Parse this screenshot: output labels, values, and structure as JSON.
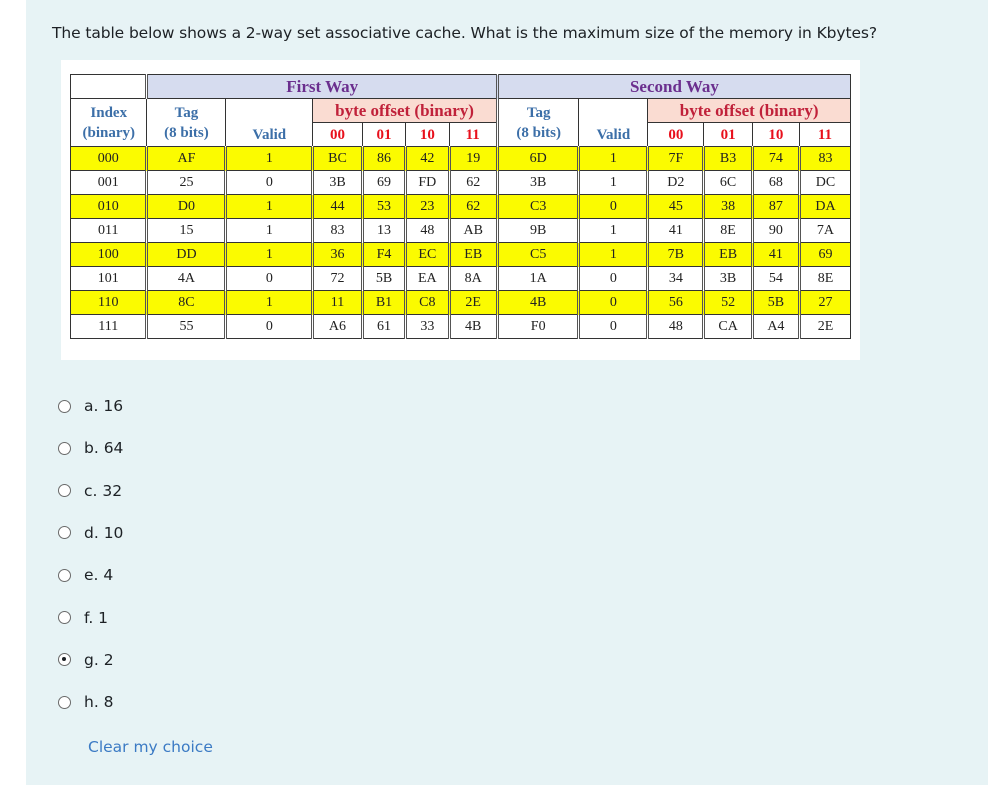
{
  "question": {
    "text": "The table below shows a 2-way set associative cache. What is the maximum size of the memory in Kbytes?"
  },
  "table": {
    "first_way_label": "First Way",
    "second_way_label": "Second Way",
    "byte_offset_label": "byte offset (binary)",
    "index_label_1": "Index",
    "index_label_2": "(binary)",
    "tag_label_1": "Tag",
    "tag_label_2": "(8 bits)",
    "valid_label": "Valid",
    "offsets": [
      "00",
      "01",
      "10",
      "11"
    ],
    "highlight_color": "#ffff00",
    "rows": [
      {
        "index": "000",
        "w1": {
          "tag": "AF",
          "valid": "1",
          "bytes": [
            "BC",
            "86",
            "42",
            "19"
          ]
        },
        "w2": {
          "tag": "6D",
          "valid": "1",
          "bytes": [
            "7F",
            "B3",
            "74",
            "83"
          ]
        },
        "highlighted": true
      },
      {
        "index": "001",
        "w1": {
          "tag": "25",
          "valid": "0",
          "bytes": [
            "3B",
            "69",
            "FD",
            "62"
          ]
        },
        "w2": {
          "tag": "3B",
          "valid": "1",
          "bytes": [
            "D2",
            "6C",
            "68",
            "DC"
          ]
        },
        "highlighted": false
      },
      {
        "index": "010",
        "w1": {
          "tag": "D0",
          "valid": "1",
          "bytes": [
            "44",
            "53",
            "23",
            "62"
          ]
        },
        "w2": {
          "tag": "C3",
          "valid": "0",
          "bytes": [
            "45",
            "38",
            "87",
            "DA"
          ]
        },
        "highlighted": true
      },
      {
        "index": "011",
        "w1": {
          "tag": "15",
          "valid": "1",
          "bytes": [
            "83",
            "13",
            "48",
            "AB"
          ]
        },
        "w2": {
          "tag": "9B",
          "valid": "1",
          "bytes": [
            "41",
            "8E",
            "90",
            "7A"
          ]
        },
        "highlighted": false
      },
      {
        "index": "100",
        "w1": {
          "tag": "DD",
          "valid": "1",
          "bytes": [
            "36",
            "F4",
            "EC",
            "EB"
          ]
        },
        "w2": {
          "tag": "C5",
          "valid": "1",
          "bytes": [
            "7B",
            "EB",
            "41",
            "69"
          ]
        },
        "highlighted": true
      },
      {
        "index": "101",
        "w1": {
          "tag": "4A",
          "valid": "0",
          "bytes": [
            "72",
            "5B",
            "EA",
            "8A"
          ]
        },
        "w2": {
          "tag": "1A",
          "valid": "0",
          "bytes": [
            "34",
            "3B",
            "54",
            "8E"
          ]
        },
        "highlighted": false
      },
      {
        "index": "110",
        "w1": {
          "tag": "8C",
          "valid": "1",
          "bytes": [
            "11",
            "B1",
            "C8",
            "2E"
          ]
        },
        "w2": {
          "tag": "4B",
          "valid": "0",
          "bytes": [
            "56",
            "52",
            "5B",
            "27"
          ]
        },
        "highlighted": true
      },
      {
        "index": "111",
        "w1": {
          "tag": "55",
          "valid": "0",
          "bytes": [
            "A6",
            "61",
            "33",
            "4B"
          ]
        },
        "w2": {
          "tag": "F0",
          "valid": "0",
          "bytes": [
            "48",
            "CA",
            "A4",
            "2E"
          ]
        },
        "highlighted": false
      }
    ]
  },
  "options": [
    {
      "label": "a. 16",
      "selected": false
    },
    {
      "label": "b. 64",
      "selected": false
    },
    {
      "label": "c. 32",
      "selected": false
    },
    {
      "label": "d. 10",
      "selected": false
    },
    {
      "label": "e. 4",
      "selected": false
    },
    {
      "label": "f. 1",
      "selected": false
    },
    {
      "label": "g. 2",
      "selected": true
    },
    {
      "label": "h. 8",
      "selected": false
    }
  ],
  "clear_choice_label": "Clear my choice"
}
